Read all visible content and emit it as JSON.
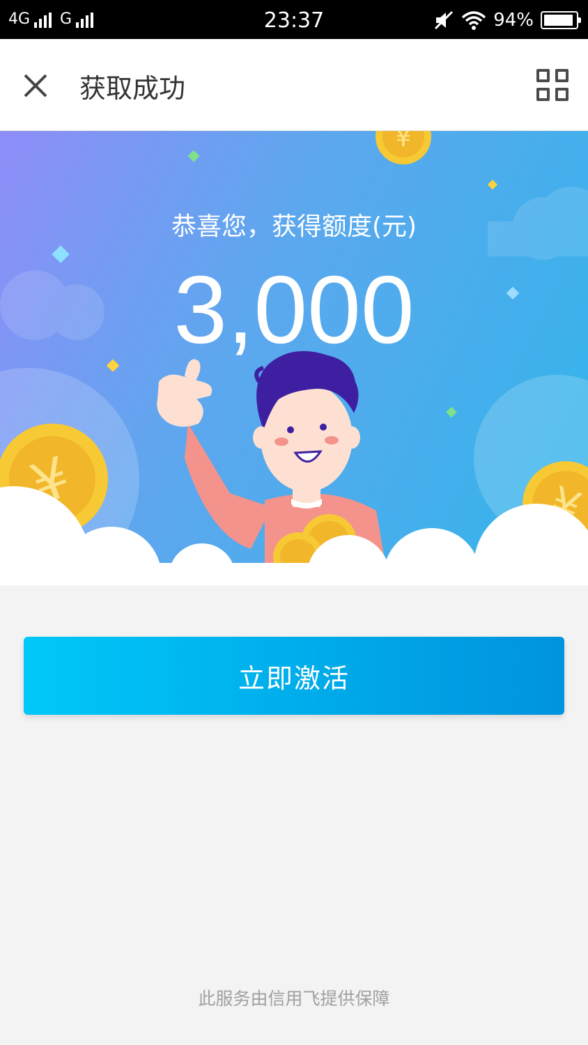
{
  "status_bar": {
    "network1": "4G",
    "network2": "G",
    "time": "23:37",
    "battery": "94%",
    "battery_level": 0.94
  },
  "nav": {
    "title": "获取成功",
    "close_icon": "close-icon",
    "menu_icon": "grid-menu-icon"
  },
  "hero": {
    "subtitle": "恭喜您，获得额度(元)",
    "amount": "3,000",
    "currency_symbol": "¥"
  },
  "actions": {
    "activate_label": "立即激活"
  },
  "footer": {
    "text": "此服务由信用飞提供保障"
  },
  "colors": {
    "accent_start": "#00c8f8",
    "accent_end": "#0093de",
    "coin": "#f7c934"
  }
}
